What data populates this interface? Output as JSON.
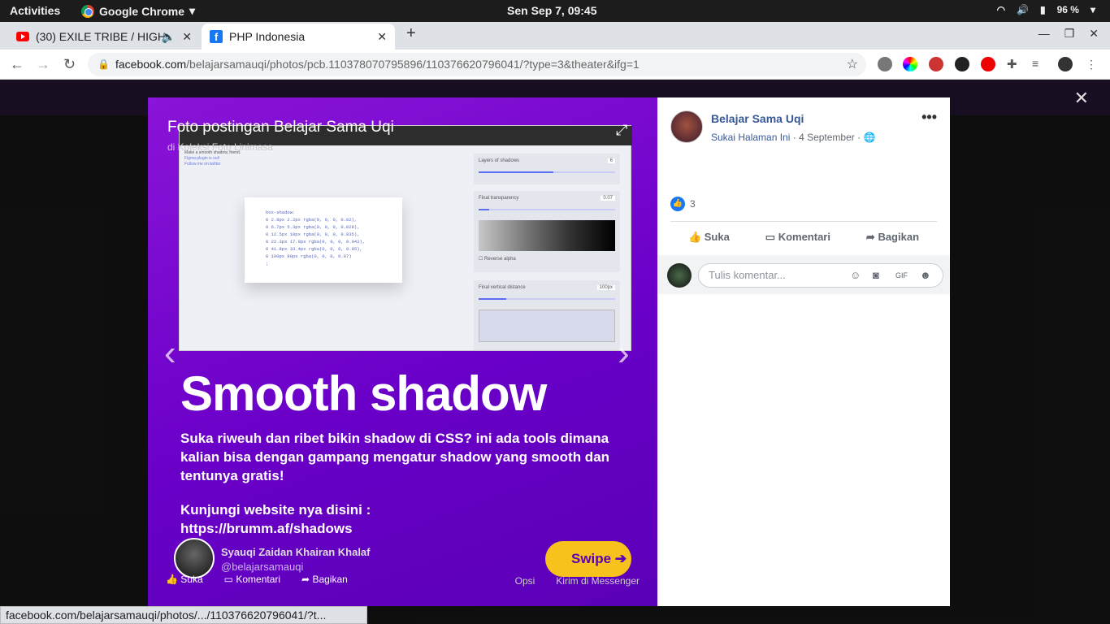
{
  "system": {
    "activities": "Activities",
    "app": "Google Chrome",
    "clock": "Sen Sep  7, 09:45",
    "battery": "96 %"
  },
  "tabs": [
    {
      "title": "(30) EXILE TRIBE / HIGH",
      "close": "✕"
    },
    {
      "title": "PHP Indonesia",
      "close": "✕"
    }
  ],
  "url": {
    "host": "facebook.com",
    "path": "/belajarsamauqi/photos/pcb.110378070795896/110376620796041/?type=3&theater&ifg=1"
  },
  "viewer": {
    "title": "Foto postingan Belajar Sama Uqi",
    "subtitle": "di Koleksi Foto Linimasa",
    "headline": "Smooth shadow",
    "paragraph": "Suka riweuh dan ribet bikin shadow di CSS? ini ada tools dimana kalian bisa dengan gampang mengatur shadow yang smooth dan tentunya gratis!",
    "visit_line1": "Kunjungi website nya disini :",
    "visit_line2": "https://brumm.af/shadows",
    "author": "Syauqi Zaidan Khairan Khalaf",
    "handle": "@belajarsamauqi",
    "swipe": "Swipe",
    "like": "Suka",
    "comment": "Komentari",
    "share": "Bagikan",
    "options": "Opsi",
    "send": "Kirim di Messenger",
    "shot": {
      "code_lines": [
        "box-shadow:",
        "0 2.8px 2.2px rgba(0, 0, 0, 0.02),",
        "0 6.7px 5.3px rgba(0, 0, 0, 0.028),",
        "0 12.5px 10px rgba(0, 0, 0, 0.035),",
        "0 22.3px 17.9px rgba(0, 0, 0, 0.042),",
        "0 41.8px 33.4px rgba(0, 0, 0, 0.05),",
        "0 100px 80px rgba(0, 0, 0, 0.07)",
        ";"
      ],
      "intro": [
        "Make a smooth shadow, friend.",
        "Figma plugin is out!",
        "Follow me on twitter"
      ],
      "panel1_label": "Layers of shadows",
      "panel1_value": "6",
      "panel2_label": "Final transparency",
      "panel2_value": "0.07",
      "reverse": "Reverse alpha",
      "panel3_label": "Final vertical distance",
      "panel3_value": "100px"
    }
  },
  "sidebar": {
    "page_name": "Belajar Sama Uqi",
    "like_page": "Sukai Halaman Ini",
    "date": "4 September",
    "reaction_count": "3",
    "like": "Suka",
    "comment": "Komentari",
    "share": "Bagikan",
    "comment_placeholder": "Tulis komentar..."
  },
  "statusbar": "facebook.com/belajarsamauqi/photos/.../110376620796041/?t..."
}
